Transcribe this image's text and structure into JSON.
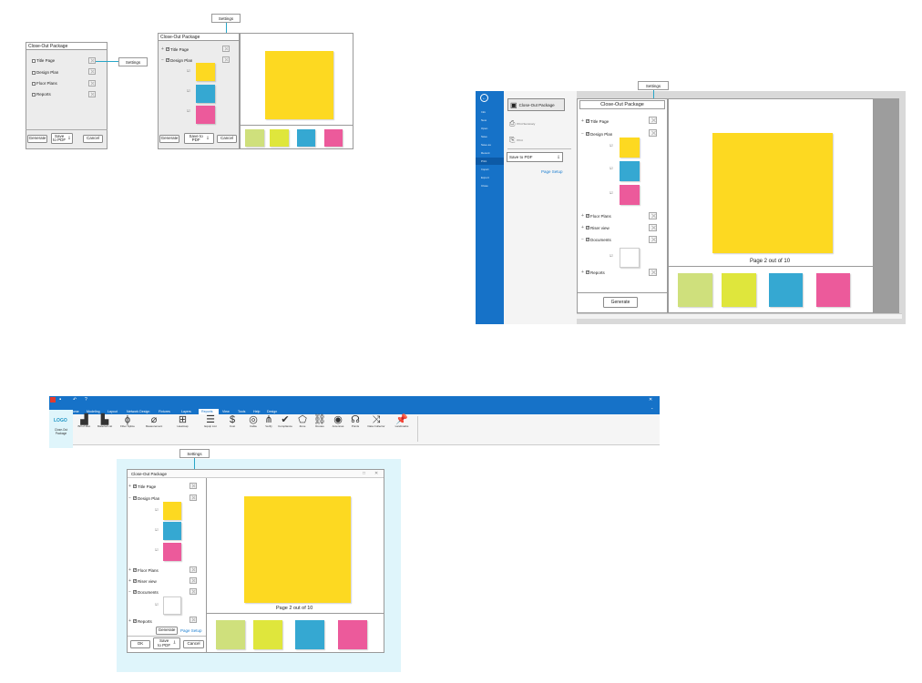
{
  "common": {
    "package_title": "Close-Out Package",
    "settings": "Settings",
    "generate": "Generate",
    "save_to_pdf": "Save to PDF",
    "cancel": "Cancel",
    "ok": "OK",
    "page_setup": "Page Setup",
    "page_counter": "Page 2 out of 10"
  },
  "tree_items": {
    "title_page": "Title Page",
    "design_plan": "Design Plan",
    "floor_plans": "Floor Plans",
    "riser_view": "Riser view",
    "documents": "Documents",
    "reports": "Reports"
  },
  "colors": {
    "yellow": "#fdd921",
    "cyan": "#35a8d2",
    "pink": "#ec5a9b",
    "light_green": "#cfe07c",
    "lime": "#dfe63c",
    "app_blue": "#1672c8",
    "highlight": "#dff5fb"
  },
  "backstage": {
    "save_dropdown": "Save to PDF",
    "page_setup": "Page Setup",
    "close_out_item": "Close-Out Package"
  },
  "ribbon": {
    "logo": "LOGO",
    "logo_caption": "Close-Out Package",
    "tabs": [
      "File",
      "Home",
      "Modeling",
      "Layout",
      "Network Design",
      "Fixtures",
      "Layers",
      "Reports",
      "View",
      "Tools",
      "Help",
      "Design"
    ],
    "active_tab": "Reports"
  }
}
